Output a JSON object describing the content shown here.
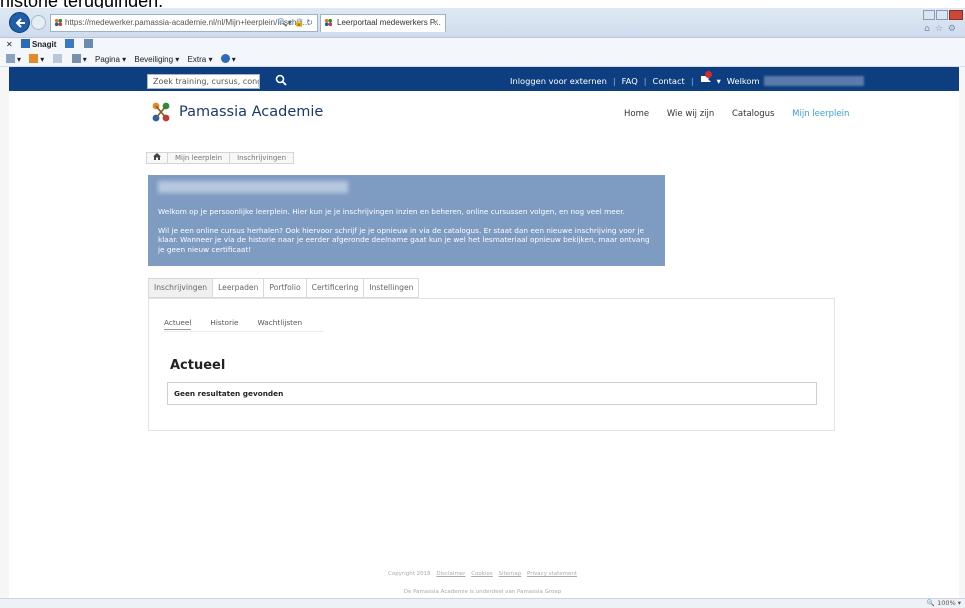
{
  "caption": "historie teruguinden.",
  "browser": {
    "url": "https://medewerker.pamassia-academie.nl/nl/Mijn+leerplein/Inschrij...",
    "tab_title": "Leerportaal medewerkers P...",
    "toolbar1": [
      "Snagit",
      "",
      ""
    ],
    "toolbar2": [
      "Pagina ▾",
      "Beveiliging ▾",
      "Extra ▾",
      "▾"
    ],
    "zoom": "100%"
  },
  "sitebar": {
    "search_placeholder": "Zoek training, cursus, congr",
    "links": [
      "Inloggen voor externen",
      "FAQ",
      "Contact"
    ],
    "welkom_label": "Welkom"
  },
  "header": {
    "logo_text": "Pamassia Academie",
    "nav": [
      "Home",
      "Wie wij zijn",
      "Catalogus",
      "Mijn leerplein"
    ]
  },
  "breadcrumb": [
    "Mijn leerplein",
    "Inschrijvingen"
  ],
  "welcome": {
    "para1": "Welkom op je persoonlijke leerplein. Hier kun je je inschrijvingen inzien en beheren, online cursussen volgen, en nog veel meer.",
    "para2": "Wil je een online cursus herhalen? Ook hiervoor schrijf je je opnieuw in via de catalogus. Er staat dan een nieuwe inschrijving voor je klaar. Wanneer je via de historie naar je eerder afgeronde deelname gaat kun je wel het lesmateriaal opnieuw bekijken, maar ontvang je geen nieuw certificaat!"
  },
  "tabs": [
    "Inschrijvingen",
    "Leerpaden",
    "Portfolio",
    "Certificering",
    "Instellingen"
  ],
  "subtabs": [
    "Actueel",
    "Historie",
    "Wachtlijsten"
  ],
  "section": {
    "title": "Actueel",
    "empty_text": "Geen resultaten gevonden"
  },
  "footer": {
    "copyright": "Copyright 2018",
    "links": [
      "Disclaimer",
      "Cookies",
      "Sitemap",
      "Privacy statement"
    ],
    "line2": "De Pamassia Academie is onderdeel van Pamassia Groep"
  },
  "colors": {
    "navbar": "#0d3e7f",
    "welcome_bg": "#7e9bc2",
    "active_link": "#3aa0d8"
  }
}
